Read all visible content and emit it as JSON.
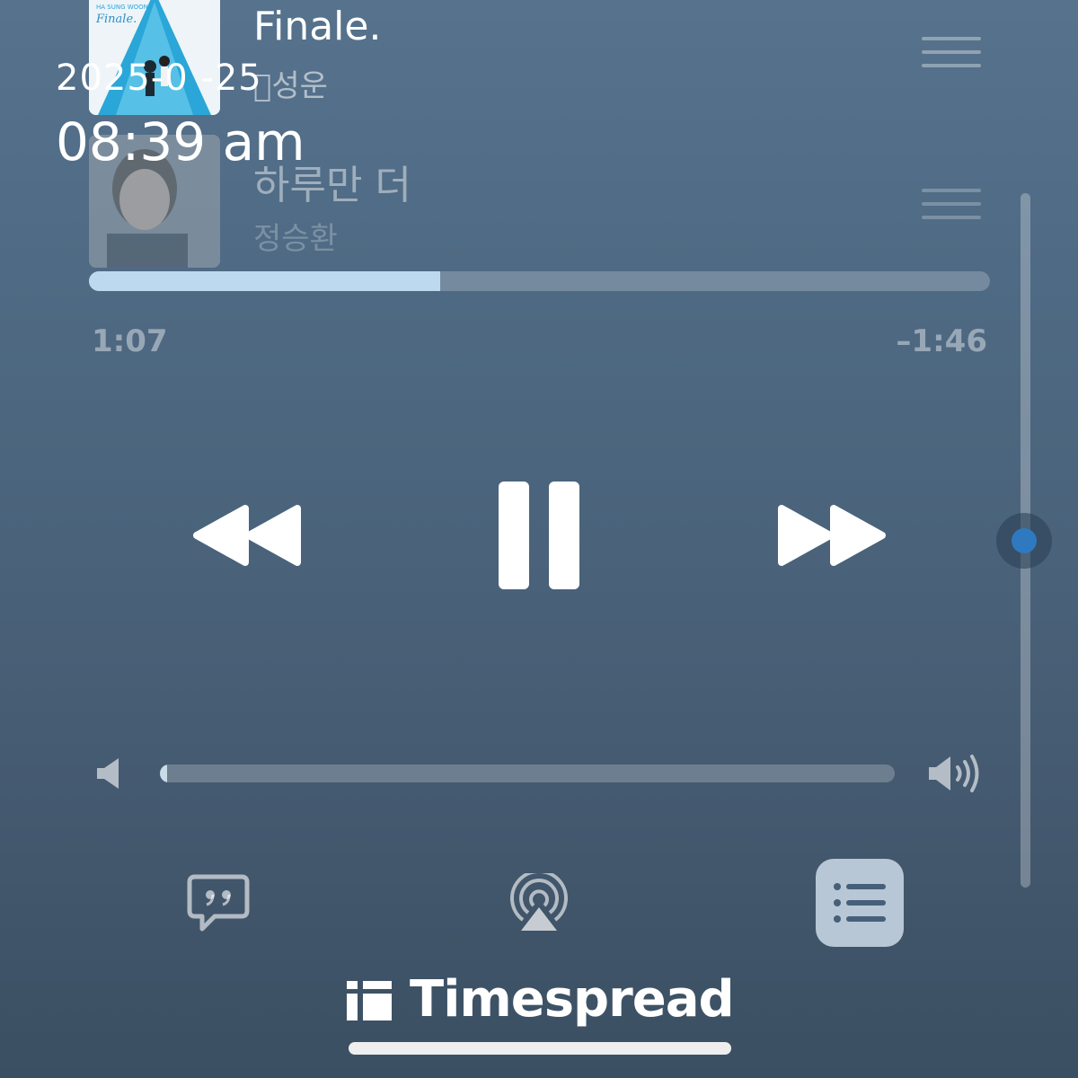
{
  "queue": [
    {
      "title": "Finale.",
      "artist": "\u0000성운",
      "art_text_brand": "HA SUNG WOON",
      "art_text_title": "Finale."
    },
    {
      "title": "하루만 더",
      "artist": "정승환"
    }
  ],
  "timestamp": {
    "date": "2025-0 -25",
    "time": "08:39 am"
  },
  "player": {
    "elapsed": "1:07",
    "remaining": "–1:46",
    "progress_fraction": 0.39,
    "volume_fraction": 0.01
  },
  "brand": {
    "name": "Timespread"
  },
  "colors": {
    "accent": "#2f79c1",
    "progress_fill": "#bcd9f0"
  },
  "icons": {
    "rewind": "rewind-icon",
    "pause": "pause-icon",
    "forward": "fast-forward-icon",
    "vol_low": "speaker-low-icon",
    "vol_high": "speaker-high-icon",
    "lyrics": "lyrics-quote-icon",
    "airplay": "airplay-icon",
    "queue": "queue-list-icon",
    "reorder": "reorder-handle-icon"
  }
}
